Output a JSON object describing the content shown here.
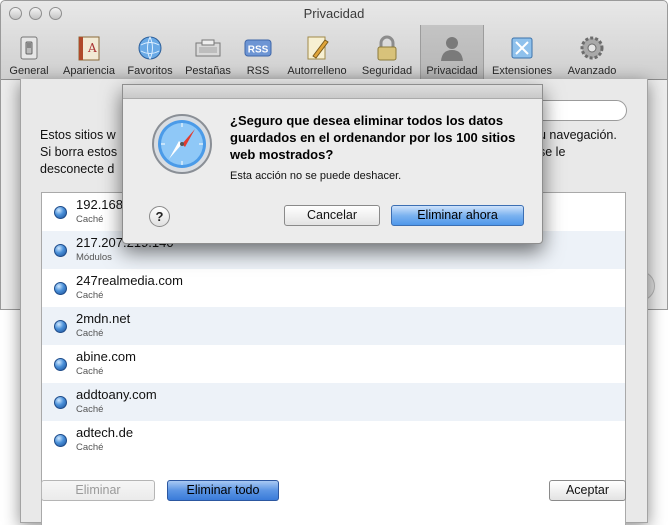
{
  "window": {
    "title": "Privacidad"
  },
  "toolbar": {
    "items": [
      {
        "label": "General",
        "icon": "switch-icon"
      },
      {
        "label": "Apariencia",
        "icon": "font-book-icon"
      },
      {
        "label": "Favoritos",
        "icon": "globe-icon"
      },
      {
        "label": "Pestañas",
        "icon": "tabs-icon"
      },
      {
        "label": "RSS",
        "icon": "rss-icon"
      },
      {
        "label": "Autorrelleno",
        "icon": "pencil-icon"
      },
      {
        "label": "Seguridad",
        "icon": "lock-icon"
      },
      {
        "label": "Privacidad",
        "icon": "person-silhouette-icon",
        "selected": true
      },
      {
        "label": "Extensiones",
        "icon": "puzzle-icon"
      },
      {
        "label": "Avanzado",
        "icon": "gear-icon"
      }
    ]
  },
  "sheet": {
    "description_partial": "Estos sitios w\nSi borra estos\ndesconecte d",
    "description_right": "u navegación.\n se le",
    "sites": [
      {
        "name": "192.168",
        "type": "Caché"
      },
      {
        "name": "217.207.219.140",
        "type": "Módulos"
      },
      {
        "name": "247realmedia.com",
        "type": "Caché"
      },
      {
        "name": "2mdn.net",
        "type": "Caché"
      },
      {
        "name": "abine.com",
        "type": "Caché"
      },
      {
        "name": "addtoany.com",
        "type": "Caché"
      },
      {
        "name": "adtech.de",
        "type": "Caché"
      }
    ],
    "buttons": {
      "remove": "Eliminar",
      "remove_all": "Eliminar todo",
      "done": "Aceptar"
    }
  },
  "alert": {
    "title": "¿Seguro que desea eliminar todos los datos guardados en el ordenandor por los 100 sitios web mostrados?",
    "info": "Esta acción no se puede deshacer.",
    "buttons": {
      "cancel": "Cancelar",
      "confirm": "Eliminar ahora",
      "help": "?"
    }
  },
  "colors": {
    "accent_button": "#5b95e4",
    "list_stripe": "#edf2f8"
  }
}
